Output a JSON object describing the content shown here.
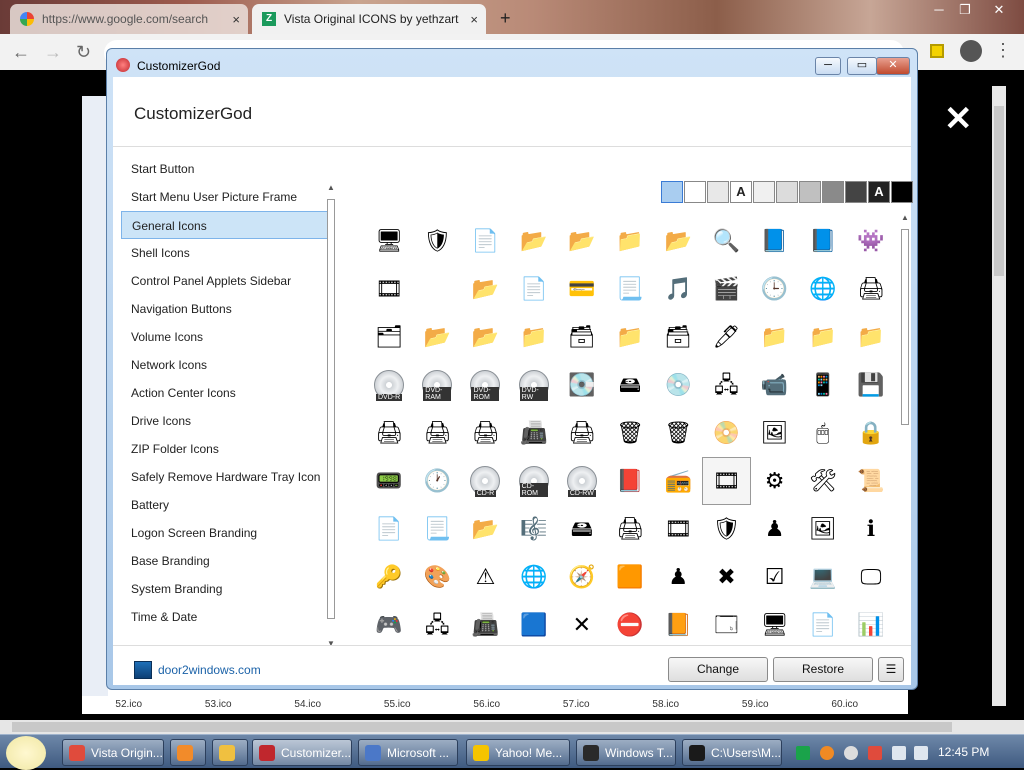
{
  "browser": {
    "tabs": [
      {
        "title": "https://www.google.com/search",
        "active": false
      },
      {
        "title": "Vista Original ICONS by yethzart",
        "active": true
      }
    ],
    "new_tab": "+",
    "tab_close": "×",
    "win_buttons": {
      "minimize": "─",
      "restore": "❐",
      "close": "✕"
    },
    "nav": {
      "back": "←",
      "forward": "→",
      "reload": "↻"
    },
    "lightbox_close": "✕"
  },
  "background_page": {
    "file_labels": [
      "52.ico",
      "53.ico",
      "54.ico",
      "55.ico",
      "56.ico",
      "57.ico",
      "58.ico",
      "59.ico",
      "60.ico"
    ]
  },
  "dialog": {
    "title": "CustomizerGod",
    "header": "CustomizerGod",
    "title_buttons": {
      "minimize": "─",
      "maximize": "▭",
      "close": "✕"
    },
    "categories": [
      "Start Button",
      "Start Menu User Picture Frame",
      "General Icons",
      "Shell Icons",
      "Control Panel Applets Sidebar",
      "Navigation Buttons",
      "Volume Icons",
      "Network Icons",
      "Action Center Icons",
      "Drive Icons",
      "ZIP Folder Icons",
      "Safely Remove Hardware Tray Icon",
      "Battery",
      "Logon Screen Branding",
      "Base Branding",
      "System Branding",
      "Time & Date"
    ],
    "selected_category": "General Icons",
    "swatches": [
      {
        "color": "#a9cdf0",
        "label": ""
      },
      {
        "color": "#ffffff",
        "label": ""
      },
      {
        "color": "#e8e8e8",
        "label": ""
      },
      {
        "color": "#ffffff",
        "label": "A"
      },
      {
        "color": "#f0f0f0",
        "label": ""
      },
      {
        "color": "#dcdcdc",
        "label": ""
      },
      {
        "color": "#c0c0c0",
        "label": ""
      },
      {
        "color": "#8a8a8a",
        "label": ""
      },
      {
        "color": "#444444",
        "label": ""
      },
      {
        "color": "#222222",
        "label": "A"
      },
      {
        "color": "#000000",
        "label": ""
      }
    ],
    "icon_rows": [
      [
        {
          "name": "computer-icon",
          "g": "🖥"
        },
        {
          "name": "shield-icon",
          "g": "🛡"
        },
        {
          "name": "blank-page-icon",
          "g": "📄"
        },
        {
          "name": "folder-icon",
          "g": "📂"
        },
        {
          "name": "folder-icon",
          "g": "📂"
        },
        {
          "name": "folder-icon",
          "g": "📁"
        },
        {
          "name": "folder-icon",
          "g": "📂"
        },
        {
          "name": "magnifier-icon",
          "g": "🔍"
        },
        {
          "name": "blue-folder-icon",
          "g": "📘"
        },
        {
          "name": "blue-folder-icon",
          "g": "📘"
        },
        {
          "name": "game-icon",
          "g": "👾"
        }
      ],
      [
        {
          "name": "media-icon",
          "g": "🎞"
        },
        {
          "name": "blank-icon",
          "g": ""
        },
        {
          "name": "folder-docs-icon",
          "g": "📂"
        },
        {
          "name": "document-icon",
          "g": "📄"
        },
        {
          "name": "card-icon",
          "g": "💳"
        },
        {
          "name": "document-icon",
          "g": "📃"
        },
        {
          "name": "music-icon",
          "g": "🎵"
        },
        {
          "name": "film-icon",
          "g": "🎬"
        },
        {
          "name": "clock-icon",
          "g": "🕒"
        },
        {
          "name": "globe-icon",
          "g": "🌐"
        },
        {
          "name": "printer-icon",
          "g": "🖨"
        }
      ],
      [
        {
          "name": "folder-user-icon",
          "g": "🗂"
        },
        {
          "name": "folder-open-icon",
          "g": "📂"
        },
        {
          "name": "folder-open-icon",
          "g": "📂"
        },
        {
          "name": "folder-network-icon",
          "g": "📁"
        },
        {
          "name": "folder-files-icon",
          "g": "🗃"
        },
        {
          "name": "folder-network-icon",
          "g": "📁"
        },
        {
          "name": "folder-files-icon",
          "g": "🗃"
        },
        {
          "name": "folder-pen-icon",
          "g": "🖊"
        },
        {
          "name": "folder-network-icon",
          "g": "📁"
        },
        {
          "name": "folder-network-icon",
          "g": "📁"
        },
        {
          "name": "folder-network-icon",
          "g": "📁"
        }
      ],
      [
        {
          "name": "dvd-r-icon",
          "g": "DVD-R"
        },
        {
          "name": "dvd-ram-icon",
          "g": "DVD-RAM"
        },
        {
          "name": "dvd-rom-icon",
          "g": "DVD-ROM"
        },
        {
          "name": "dvd-rw-icon",
          "g": "DVD-RW"
        },
        {
          "name": "drive-icon",
          "g": "💽"
        },
        {
          "name": "drive-icon",
          "g": "🖴"
        },
        {
          "name": "drive-icon",
          "g": "💿"
        },
        {
          "name": "network-drive-icon",
          "g": "🖧"
        },
        {
          "name": "camera-icon",
          "g": "📹"
        },
        {
          "name": "phone-icon",
          "g": "📱"
        },
        {
          "name": "save-ok-icon",
          "g": "💾"
        }
      ],
      [
        {
          "name": "printer-ok-icon",
          "g": "🖨"
        },
        {
          "name": "printer-icon",
          "g": "🖨"
        },
        {
          "name": "printer-icon",
          "g": "🖨"
        },
        {
          "name": "fax-icon",
          "g": "📠"
        },
        {
          "name": "printer-icon",
          "g": "🖨"
        },
        {
          "name": "recycle-bin-icon",
          "g": "🗑"
        },
        {
          "name": "recycle-bin-full-icon",
          "g": "🗑"
        },
        {
          "name": "dvd-icon",
          "g": "📀"
        },
        {
          "name": "pictures-folder-icon",
          "g": "🖼"
        },
        {
          "name": "mouse-icon",
          "g": "🖱"
        },
        {
          "name": "lock-icon",
          "g": "🔒"
        }
      ],
      [
        {
          "name": "device-icon",
          "g": "📟"
        },
        {
          "name": "clock-icon",
          "g": "🕐"
        },
        {
          "name": "cd-r-icon",
          "g": "CD-R"
        },
        {
          "name": "cd-rom-icon",
          "g": "CD-ROM"
        },
        {
          "name": "cd-rw-icon",
          "g": "CD-RW"
        },
        {
          "name": "book-icon",
          "g": "📕"
        },
        {
          "name": "player-icon",
          "g": "📻"
        },
        {
          "name": "media-folder-icon",
          "g": "🎞"
        },
        {
          "name": "settings-folder-icon",
          "g": "⚙"
        },
        {
          "name": "settings-icon",
          "g": "🛠"
        },
        {
          "name": "paper-icon",
          "g": "📜"
        }
      ],
      [
        {
          "name": "document-icon",
          "g": "📄"
        },
        {
          "name": "document-icon",
          "g": "📃"
        },
        {
          "name": "folder-icon",
          "g": "📂"
        },
        {
          "name": "music-folder-icon",
          "g": "🎼"
        },
        {
          "name": "drive-icon",
          "g": "🖴"
        },
        {
          "name": "scanner-icon",
          "g": "🖨"
        },
        {
          "name": "media-folder-icon",
          "g": "🎞"
        },
        {
          "name": "uac-shield-icon",
          "g": "🛡"
        },
        {
          "name": "user-icon",
          "g": "♟"
        },
        {
          "name": "picture-icon",
          "g": "🖼"
        },
        {
          "name": "info-icon",
          "g": "ℹ"
        }
      ],
      [
        {
          "name": "key-icon",
          "g": "🔑"
        },
        {
          "name": "paint-icon",
          "g": "🎨"
        },
        {
          "name": "warning-icon",
          "g": "⚠"
        },
        {
          "name": "web-document-icon",
          "g": "🌐"
        },
        {
          "name": "network-icon",
          "g": "🧭"
        },
        {
          "name": "card-icon",
          "g": "🟧"
        },
        {
          "name": "user-icon",
          "g": "♟"
        },
        {
          "name": "red-x-icon",
          "g": "✖"
        },
        {
          "name": "checklist-icon",
          "g": "☑"
        },
        {
          "name": "drive-icon",
          "g": "💻"
        },
        {
          "name": "screen-icon",
          "g": "🖵"
        }
      ],
      [
        {
          "name": "gadget-icon",
          "g": "🎮"
        },
        {
          "name": "network-adapter-icon",
          "g": "🖧"
        },
        {
          "name": "scanner-icon",
          "g": "📠"
        },
        {
          "name": "blue-box-icon",
          "g": "🟦"
        },
        {
          "name": "small-x-icon",
          "g": "✕"
        },
        {
          "name": "error-icon",
          "g": "⛔"
        },
        {
          "name": "help-book-icon",
          "g": "📙"
        },
        {
          "name": "window-icon",
          "g": "🗔"
        },
        {
          "name": "monitor-icon",
          "g": "🖥"
        },
        {
          "name": "document-icon",
          "g": "📄"
        },
        {
          "name": "presentation-icon",
          "g": "📊"
        }
      ],
      [
        {
          "name": "shield-icon",
          "g": "🛡"
        },
        {
          "name": "shield-icon",
          "g": "🛡"
        },
        {
          "name": "shield-icon",
          "g": "🛡"
        },
        {
          "name": "shield-icon",
          "g": "🛡"
        },
        {
          "name": "icon",
          "g": "📁"
        },
        {
          "name": "icon",
          "g": "📁"
        },
        {
          "name": "icon",
          "g": "📁"
        },
        {
          "name": "icon",
          "g": "📁"
        },
        {
          "name": "icon",
          "g": "📁"
        },
        {
          "name": "icon",
          "g": "📁"
        },
        {
          "name": "icon",
          "g": "📁"
        }
      ]
    ],
    "selected_icon": {
      "row": 5,
      "col": 7
    },
    "footer": {
      "brand": "door2windows.com",
      "change_label": "Change",
      "restore_label": "Restore",
      "menu_icon": "☰"
    }
  },
  "taskbar": {
    "items": [
      {
        "label": "Vista Origin...",
        "color": "#e04b3c",
        "active": false
      },
      {
        "label": "",
        "color": "#f28b2a",
        "active": false
      },
      {
        "label": "",
        "color": "#f0c040",
        "active": false
      },
      {
        "label": "Customizer...",
        "color": "#c0272d",
        "active": true
      },
      {
        "label": "Microsoft ...",
        "color": "#4b78c8",
        "active": false
      },
      {
        "label": "Yahoo! Me...",
        "color": "#f5c400",
        "active": false
      },
      {
        "label": "Windows T...",
        "color": "#2a2a2a",
        "active": false
      },
      {
        "label": "C:\\Users\\M...",
        "color": "#1a1a1a",
        "active": false
      }
    ],
    "clock": "12:45 PM"
  }
}
